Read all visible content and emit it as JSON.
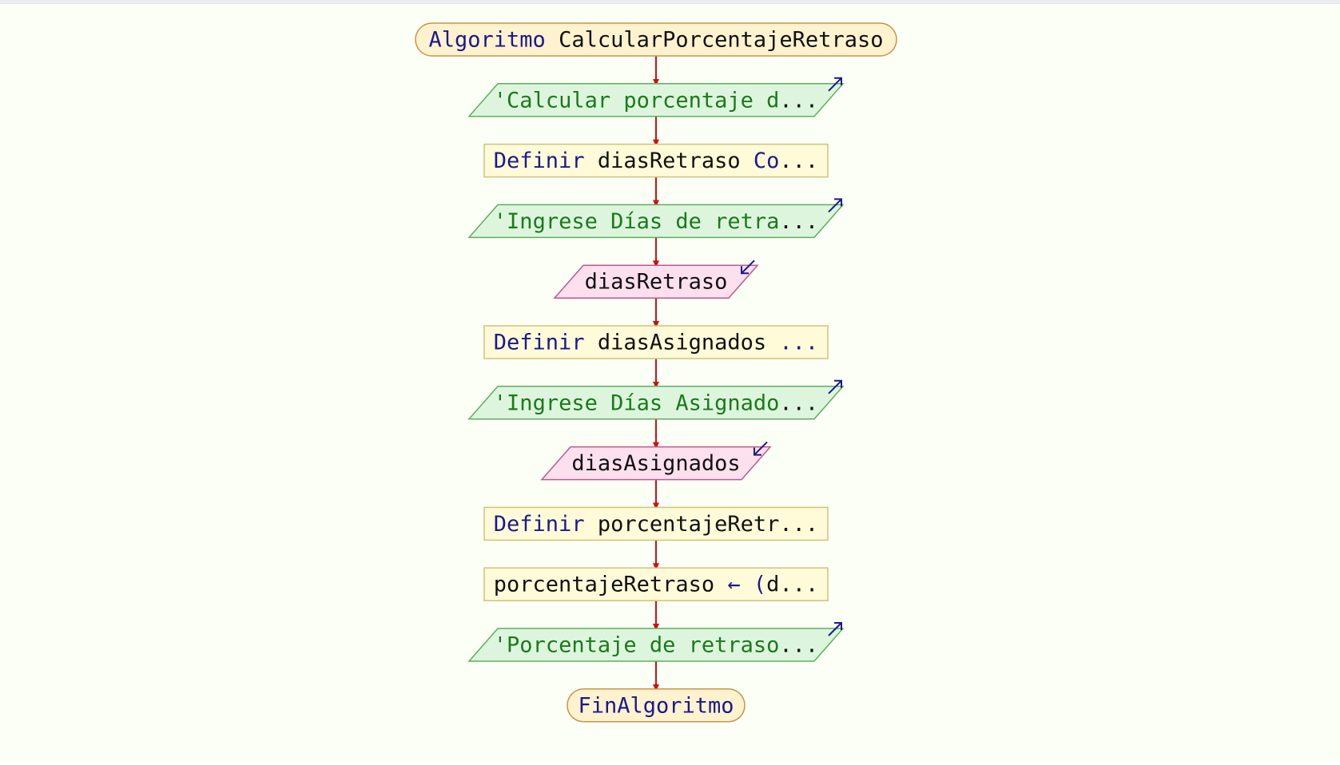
{
  "diagram": {
    "type": "flowchart",
    "nodes": [
      {
        "id": "start",
        "kind": "terminal",
        "parts": [
          {
            "t": "Algoritmo",
            "c": "kw"
          },
          {
            "t": " CalcularPorcentajeRetraso",
            "c": "id"
          }
        ]
      },
      {
        "id": "out1",
        "kind": "output",
        "parts": [
          {
            "t": "'Calcular porcentaje d",
            "c": "str"
          },
          {
            "t": "...",
            "c": "id"
          }
        ]
      },
      {
        "id": "def1",
        "kind": "process",
        "parts": [
          {
            "t": "Definir",
            "c": "kw"
          },
          {
            "t": " diasRetraso ",
            "c": "id"
          },
          {
            "t": "Co",
            "c": "kw"
          },
          {
            "t": "...",
            "c": "id"
          }
        ]
      },
      {
        "id": "out2",
        "kind": "output",
        "parts": [
          {
            "t": "'Ingrese Días de retra",
            "c": "str"
          },
          {
            "t": "...",
            "c": "id"
          }
        ]
      },
      {
        "id": "in1",
        "kind": "input",
        "parts": [
          {
            "t": "diasRetraso",
            "c": "id"
          }
        ]
      },
      {
        "id": "def2",
        "kind": "process",
        "parts": [
          {
            "t": "Definir",
            "c": "kw"
          },
          {
            "t": " diasAsignados ",
            "c": "id"
          },
          {
            "t": "...",
            "c": "kw"
          }
        ]
      },
      {
        "id": "out3",
        "kind": "output",
        "parts": [
          {
            "t": "'Ingrese Días Asignado",
            "c": "str"
          },
          {
            "t": "...",
            "c": "id"
          }
        ]
      },
      {
        "id": "in2",
        "kind": "input",
        "parts": [
          {
            "t": "diasAsignados",
            "c": "id"
          }
        ]
      },
      {
        "id": "def3",
        "kind": "process",
        "parts": [
          {
            "t": "Definir",
            "c": "kw"
          },
          {
            "t": " porcentajeRetr",
            "c": "id"
          },
          {
            "t": "...",
            "c": "id"
          }
        ]
      },
      {
        "id": "asg1",
        "kind": "process",
        "parts": [
          {
            "t": "porcentajeRetraso ",
            "c": "id"
          },
          {
            "t": "← (",
            "c": "kw"
          },
          {
            "t": "d",
            "c": "id"
          },
          {
            "t": "...",
            "c": "id"
          }
        ]
      },
      {
        "id": "out4",
        "kind": "output",
        "parts": [
          {
            "t": "'Porcentaje de retraso",
            "c": "str"
          },
          {
            "t": "...",
            "c": "id"
          }
        ]
      },
      {
        "id": "end",
        "kind": "terminal",
        "parts": [
          {
            "t": "FinAlgoritmo",
            "c": "kw"
          }
        ]
      }
    ],
    "edges": [
      [
        "start",
        "out1"
      ],
      [
        "out1",
        "def1"
      ],
      [
        "def1",
        "out2"
      ],
      [
        "out2",
        "in1"
      ],
      [
        "in1",
        "def2"
      ],
      [
        "def2",
        "out3"
      ],
      [
        "out3",
        "in2"
      ],
      [
        "in2",
        "def3"
      ],
      [
        "def3",
        "asg1"
      ],
      [
        "asg1",
        "out4"
      ],
      [
        "out4",
        "end"
      ]
    ],
    "colors": {
      "terminal_fill": "#fff2cf",
      "terminal_stroke": "#c8944a",
      "output_fill": "#ddf5dd",
      "output_stroke": "#5fae5f",
      "process_fill": "#fffbd8",
      "process_stroke": "#cfc27a",
      "input_fill": "#fde0ee",
      "input_stroke": "#c0578e",
      "arrow": "#cc1111",
      "output_glyph": "#1a1a8c",
      "input_glyph": "#1a1a8c"
    },
    "glyphs": {
      "output": "arrow-ne-icon",
      "input": "arrow-sw-icon"
    }
  }
}
